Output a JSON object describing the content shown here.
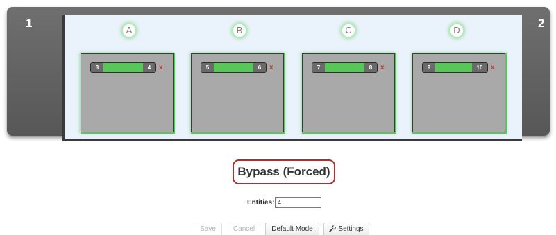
{
  "frame": {
    "left_number": "1",
    "right_number": "2"
  },
  "slots": [
    {
      "letter": "A",
      "left_value": "3",
      "right_value": "4"
    },
    {
      "letter": "B",
      "left_value": "5",
      "right_value": "6"
    },
    {
      "letter": "C",
      "left_value": "7",
      "right_value": "8"
    },
    {
      "letter": "D",
      "left_value": "9",
      "right_value": "10"
    }
  ],
  "remove_label": "x",
  "mode": {
    "label": "Bypass (Forced)"
  },
  "entities": {
    "label": "Entities:",
    "value": "4"
  },
  "buttons": {
    "save": "Save",
    "cancel": "Cancel",
    "default_mode": "Default Mode",
    "settings": "Settings"
  },
  "colors": {
    "accent_green": "#59c659",
    "remove_red": "#c0392b",
    "mode_border": "#a83232"
  }
}
